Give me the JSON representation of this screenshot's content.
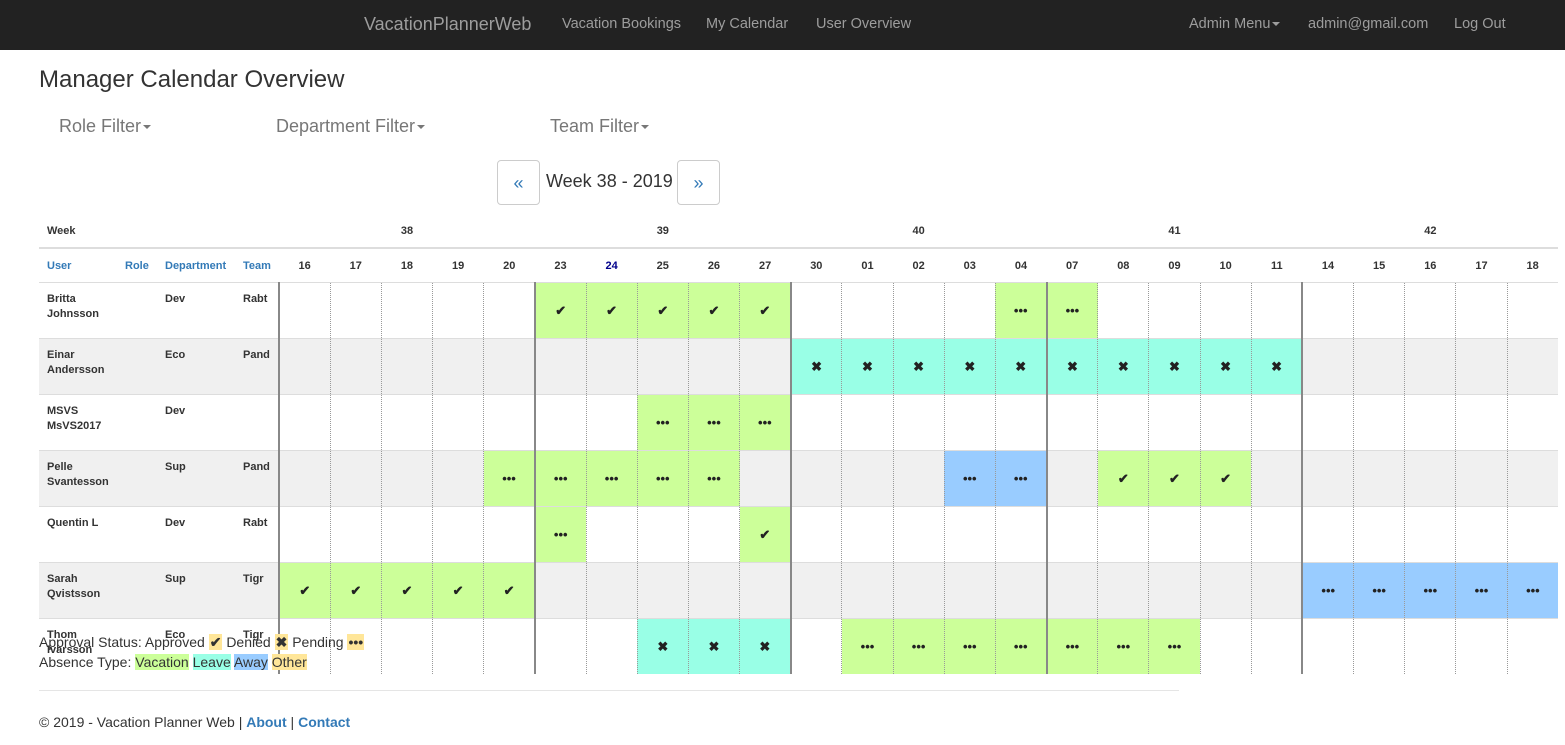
{
  "nav": {
    "brand": "VacationPlannerWeb",
    "links": [
      "Vacation Bookings",
      "My Calendar",
      "User Overview"
    ],
    "admin_menu": "Admin Menu",
    "user_email": "admin@gmail.com",
    "logout": "Log Out"
  },
  "page_title": "Manager Calendar Overview",
  "filters": {
    "role": "Role Filter",
    "department": "Department Filter",
    "team": "Team Filter"
  },
  "pager": {
    "prev": "«",
    "next": "»",
    "title": "Week 38 - 2019"
  },
  "calendar": {
    "week_label": "Week",
    "weeks": [
      "38",
      "39",
      "40",
      "41",
      "42"
    ],
    "headers": {
      "user": "User",
      "role": "Role",
      "department": "Department",
      "team": "Team"
    },
    "days": [
      "16",
      "17",
      "18",
      "19",
      "20",
      "23",
      "24",
      "25",
      "26",
      "27",
      "30",
      "01",
      "02",
      "03",
      "04",
      "07",
      "08",
      "09",
      "10",
      "11",
      "14",
      "15",
      "16",
      "17",
      "18"
    ],
    "today_index": 6,
    "rows": [
      {
        "name": "Britta Johnsson",
        "role": "",
        "department": "Dev",
        "team": "Rabt",
        "cells": [
          "",
          "",
          "",
          "",
          "",
          "VA",
          "VA",
          "VA",
          "VA",
          "VA",
          "",
          "",
          "",
          "",
          "VP",
          "VP",
          "",
          "",
          "",
          "",
          "",
          "",
          "",
          "",
          ""
        ]
      },
      {
        "name": "Einar Andersson",
        "role": "",
        "department": "Eco",
        "team": "Pand",
        "cells": [
          "",
          "",
          "",
          "",
          "",
          "",
          "",
          "",
          "",
          "",
          "LD",
          "LD",
          "LD",
          "LD",
          "LD",
          "LD",
          "LD",
          "LD",
          "LD",
          "LD",
          "",
          "",
          "",
          "",
          ""
        ]
      },
      {
        "name": "MSVS MsVS2017",
        "role": "",
        "department": "Dev",
        "team": "",
        "cells": [
          "",
          "",
          "",
          "",
          "",
          "",
          "",
          "VP",
          "VP",
          "VP",
          "",
          "",
          "",
          "",
          "",
          "",
          "",
          "",
          "",
          "",
          "",
          "",
          "",
          "",
          ""
        ]
      },
      {
        "name": "Pelle Svantesson",
        "role": "",
        "department": "Sup",
        "team": "Pand",
        "cells": [
          "",
          "",
          "",
          "",
          "VP",
          "VP",
          "VP",
          "VP",
          "VP",
          "",
          "",
          "",
          "",
          "WP",
          "WP",
          "",
          "VA",
          "VA",
          "VA",
          "",
          "",
          "",
          "",
          "",
          ""
        ]
      },
      {
        "name": "Quentin L",
        "role": "",
        "department": "Dev",
        "team": "Rabt",
        "cells": [
          "",
          "",
          "",
          "",
          "",
          "VP",
          "",
          "",
          "",
          "VA",
          "",
          "",
          "",
          "",
          "",
          "",
          "",
          "",
          "",
          "",
          "",
          "",
          "",
          "",
          ""
        ]
      },
      {
        "name": "Sarah Qvistsson",
        "role": "",
        "department": "Sup",
        "team": "Tigr",
        "cells": [
          "VA",
          "VA",
          "VA",
          "VA",
          "VA",
          "",
          "",
          "",
          "",
          "",
          "",
          "",
          "",
          "",
          "",
          "",
          "",
          "",
          "",
          "",
          "WP",
          "WP",
          "WP",
          "WP",
          "WP"
        ]
      },
      {
        "name": "Thom Ivarsson",
        "role": "",
        "department": "Eco",
        "team": "Tigr",
        "cells": [
          "",
          "",
          "",
          "",
          "",
          "",
          "",
          "LD",
          "LD",
          "LD",
          "",
          "VP",
          "VP",
          "VP",
          "VP",
          "VP",
          "VP",
          "VP",
          "",
          "",
          "",
          "",
          "",
          "",
          ""
        ]
      }
    ]
  },
  "status_icons": {
    "approved": "✔",
    "denied": "✖",
    "pending": "•••"
  },
  "legend": {
    "approval_label": "Approval Status:",
    "approved": "Approved",
    "denied": "Denied",
    "pending": "Pending",
    "absence_label": "Absence Type:",
    "vacation": "Vacation",
    "leave": "Leave",
    "away": "Away",
    "other": "Other"
  },
  "colors": {
    "vacation": "#ccff99",
    "leave": "#99ffe6",
    "away": "#99ccff",
    "other": "#ffe699",
    "link": "#337ab7",
    "navbar": "#222222"
  },
  "footer": {
    "text": "© 2019 - Vacation Planner Web |",
    "about": "About",
    "separator": "|",
    "contact": "Contact"
  }
}
